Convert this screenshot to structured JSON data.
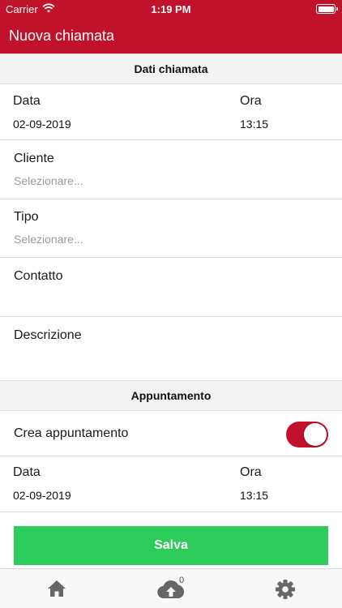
{
  "status_bar": {
    "carrier": "Carrier",
    "time": "1:19 PM"
  },
  "nav": {
    "title": "Nuova chiamata"
  },
  "section_call": {
    "header": "Dati chiamata",
    "date_label": "Data",
    "date_value": "02-09-2019",
    "time_label": "Ora",
    "time_value": "13:15",
    "client_label": "Cliente",
    "client_placeholder": "Selezionare...",
    "type_label": "Tipo",
    "type_placeholder": "Selezionare...",
    "contact_label": "Contatto",
    "description_label": "Descrizione"
  },
  "section_appointment": {
    "header": "Appuntamento",
    "create_label": "Crea appuntamento",
    "create_enabled": true,
    "date_label": "Data",
    "date_value": "02-09-2019",
    "time_label": "Ora",
    "time_value": "13:15"
  },
  "save_label": "Salva",
  "tabbar": {
    "tabs": [
      {
        "icon": "home-icon"
      },
      {
        "icon": "cloud-upload-icon",
        "badge": "0"
      },
      {
        "icon": "gear-icon"
      }
    ]
  },
  "colors": {
    "accent": "#c1122b",
    "save": "#2dcb5a",
    "section_bg": "#f2f2f2",
    "placeholder": "#9a9a9a"
  }
}
